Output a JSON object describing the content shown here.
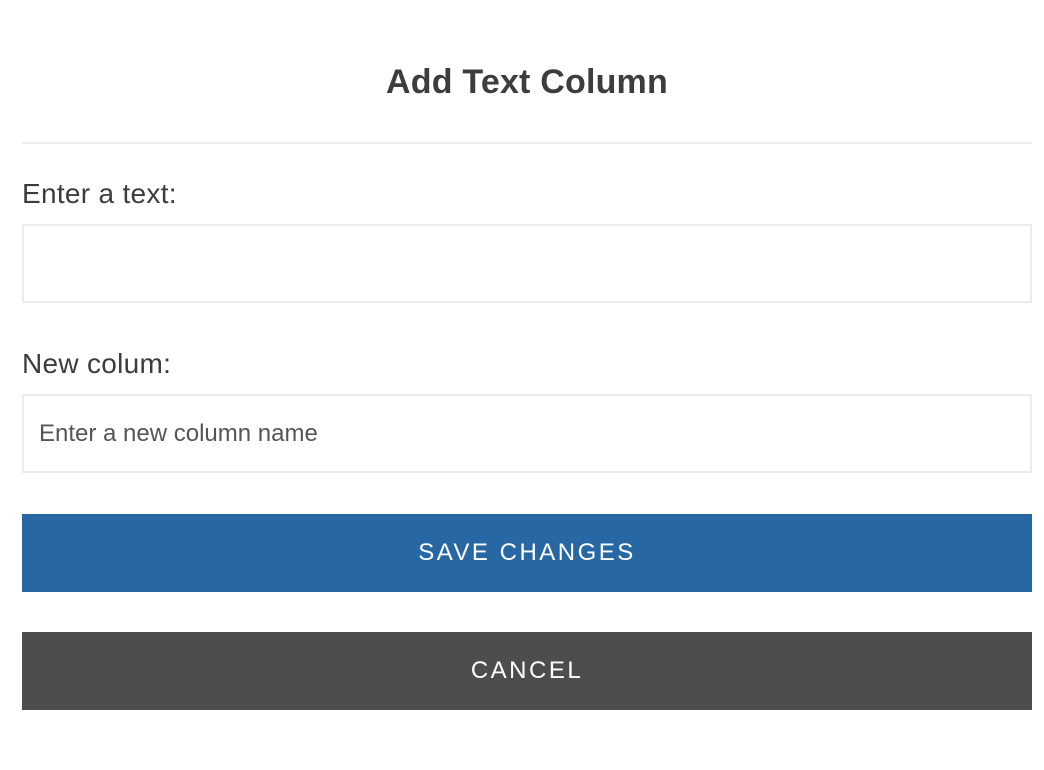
{
  "dialog": {
    "title": "Add Text Column"
  },
  "fields": {
    "text": {
      "label": "Enter a text:",
      "value": "",
      "placeholder": ""
    },
    "column": {
      "label": "New colum:",
      "value": "",
      "placeholder": "Enter a new column name"
    }
  },
  "buttons": {
    "save_label": "SAVE CHANGES",
    "cancel_label": "CANCEL"
  },
  "colors": {
    "save_button": "#2667a4",
    "cancel_button": "#4d4d4d",
    "title_text": "#3d3d3d",
    "divider": "#ececec"
  }
}
